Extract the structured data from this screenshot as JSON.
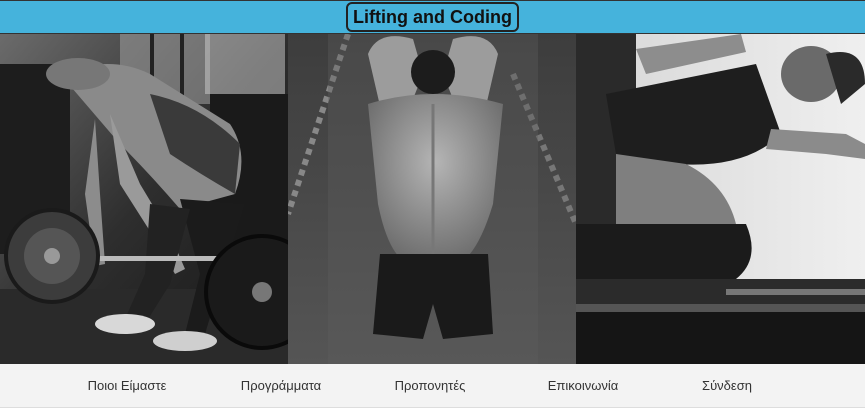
{
  "header": {
    "title": "Lifting and Coding",
    "color": "#45b3dc"
  },
  "images": [
    {
      "description": "deadlift-photo",
      "tone": "grayscale"
    },
    {
      "description": "back-stretch-photo",
      "tone": "grayscale"
    },
    {
      "description": "pilates-side-stretch-photo",
      "tone": "grayscale"
    }
  ],
  "nav": {
    "items": [
      {
        "label": "Ποιοι Είμαστε"
      },
      {
        "label": "Προγράμματα"
      },
      {
        "label": "Προπονητές"
      },
      {
        "label": "Επικοινωνία"
      },
      {
        "label": "Σύνδεση"
      }
    ]
  }
}
